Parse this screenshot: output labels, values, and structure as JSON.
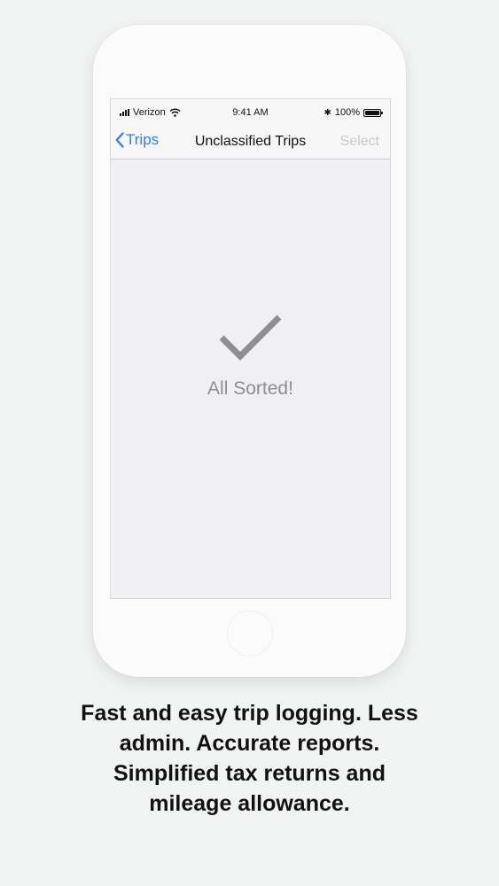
{
  "status_bar": {
    "carrier": "Verizon",
    "time": "9:41 AM",
    "battery": "100%",
    "battery_level": 1.0,
    "icons": [
      "signal-icon",
      "wifi-icon",
      "bluetooth-icon",
      "battery-icon"
    ]
  },
  "nav": {
    "back_label": "Trips",
    "title": "Unclassified Trips",
    "select_label": "Select",
    "back_icon": "chevron-left-icon"
  },
  "empty_state": {
    "icon": "checkmark-icon",
    "message": "All Sorted!"
  },
  "caption": {
    "line1": "Fast and easy trip logging. Less",
    "line2": "admin. Accurate reports.",
    "line3": "Simplified tax returns and",
    "line4": "mileage allowance."
  },
  "colors": {
    "accent": "#2f7cf6",
    "disabled": "#c9c9ce",
    "empty_gray": "#8e8e93",
    "background": "#f2f4f4"
  }
}
